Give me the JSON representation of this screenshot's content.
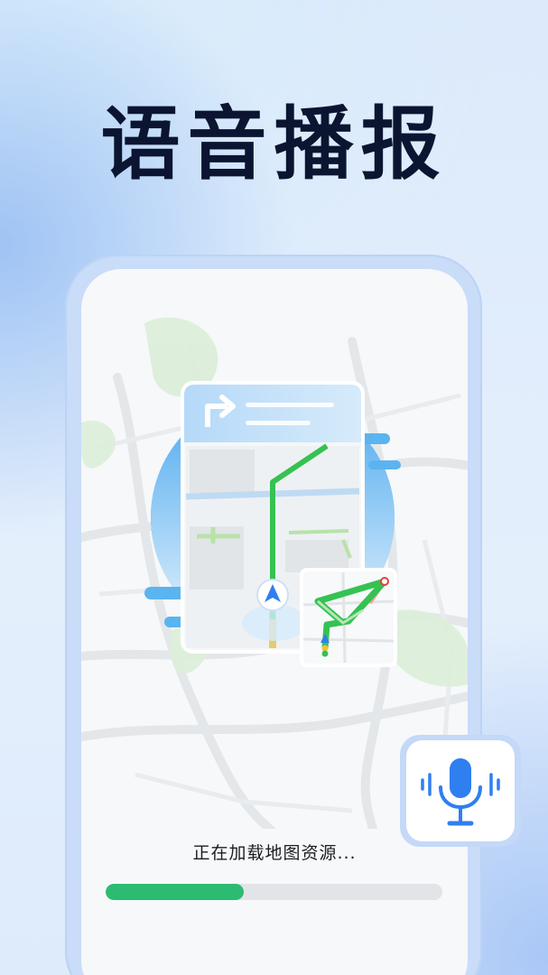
{
  "headline": "语音播报",
  "loading": {
    "text": "正在加载地图资源...",
    "progress": 0.41
  },
  "colors": {
    "accent_green": "#2dbb72",
    "route_green": "#35c252",
    "brand_blue": "#2f7ff0",
    "headline": "#0b1531"
  },
  "icons": {
    "turn": "turn-right-arrow-icon",
    "navigation": "navigation-arrow-icon",
    "microphone": "microphone-icon"
  }
}
